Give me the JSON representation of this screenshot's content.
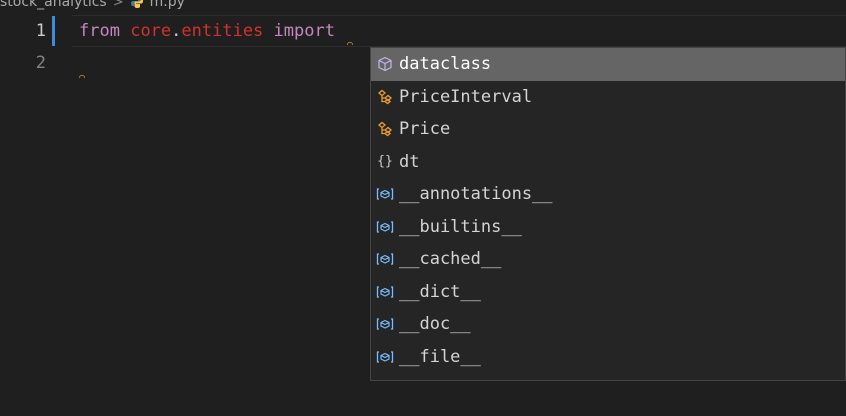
{
  "breadcrumb": {
    "folder": "stock_analytics",
    "separator": ">",
    "file": "m.py"
  },
  "editor": {
    "line_numbers": [
      "1",
      "2"
    ],
    "code": {
      "kw_from": "from",
      "module_a": "core",
      "dot": ".",
      "module_b": "entities",
      "kw_import": "import"
    }
  },
  "suggestions": {
    "selected_index": 0,
    "items": [
      {
        "label": "dataclass",
        "icon": "module-cube-icon"
      },
      {
        "label": "PriceInterval",
        "icon": "class-icon"
      },
      {
        "label": "Price",
        "icon": "class-icon"
      },
      {
        "label": "dt",
        "icon": "namespace-braces-icon"
      },
      {
        "label": "__annotations__",
        "icon": "variable-icon"
      },
      {
        "label": "__builtins__",
        "icon": "variable-icon"
      },
      {
        "label": "__cached__",
        "icon": "variable-icon"
      },
      {
        "label": "__dict__",
        "icon": "variable-icon"
      },
      {
        "label": "__doc__",
        "icon": "variable-icon"
      },
      {
        "label": "__file__",
        "icon": "variable-icon"
      }
    ]
  },
  "colors": {
    "background": "#1f1f1f",
    "keyword": "#c586c0",
    "module": "#d2322d",
    "selection": "#656565",
    "class_icon": "#ee9d28",
    "variable_icon": "#75beff",
    "cube_icon": "#b180d7"
  }
}
